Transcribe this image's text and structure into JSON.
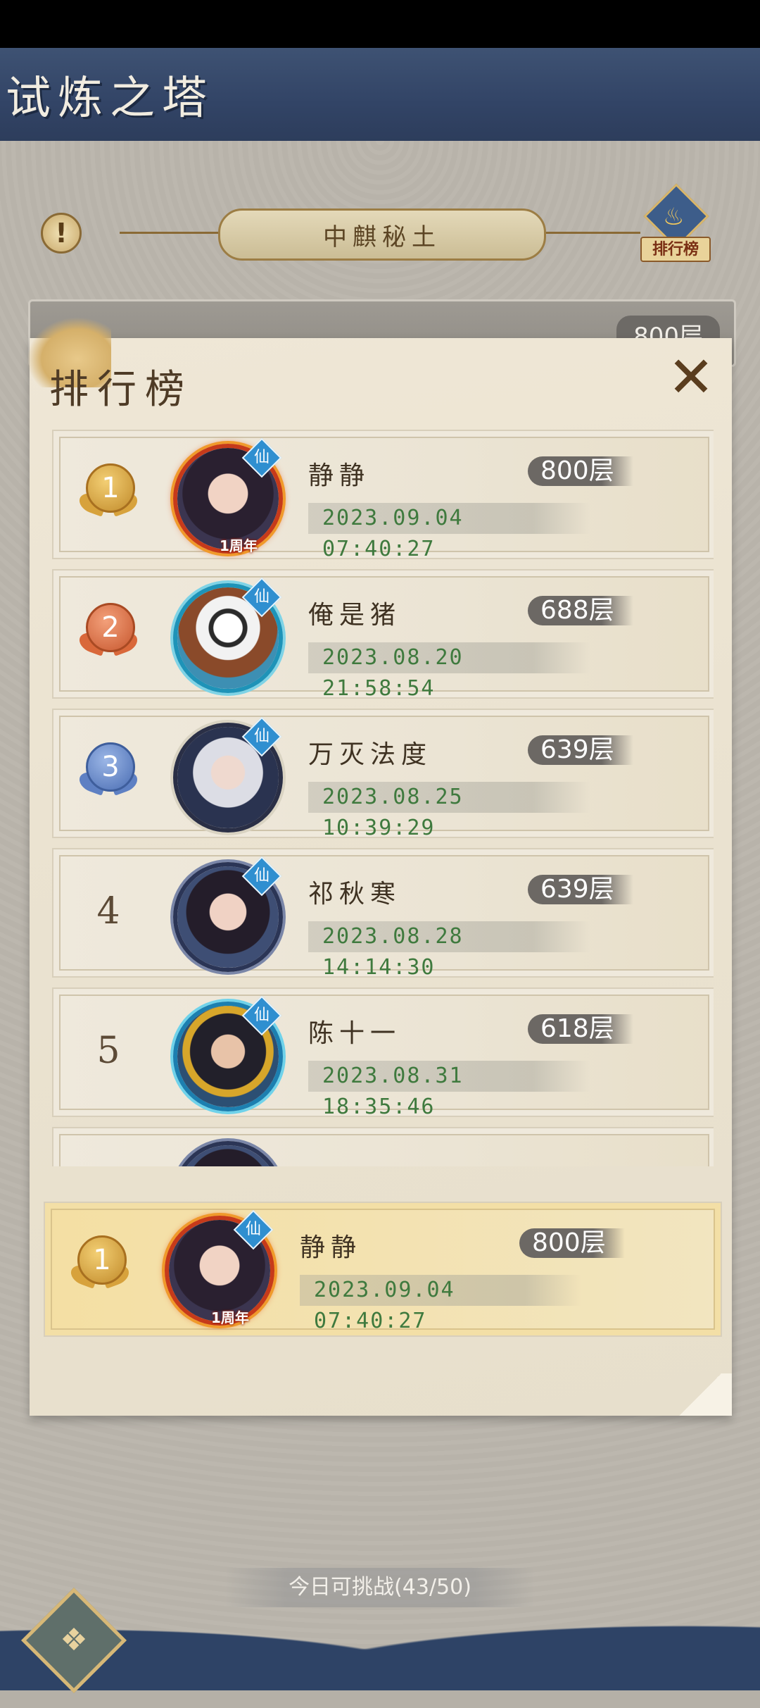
{
  "header": {
    "title": "试炼之塔"
  },
  "stage": {
    "name": "中麒秘土",
    "info_icon": "!"
  },
  "rank_button": {
    "label": "排行榜",
    "icon": "flame-emblem-icon"
  },
  "tower": {
    "floor_label": "800层"
  },
  "panel": {
    "title": "排行榜",
    "close_icon": "✕",
    "entries": [
      {
        "rank": "1",
        "medal": "gold",
        "name": "静静",
        "floor": "800层",
        "time": "2023.09.04  07:40:27",
        "avatar_badge": "仙",
        "frame_tag": "1周年"
      },
      {
        "rank": "2",
        "medal": "silver",
        "name": "俺是猪",
        "floor": "688层",
        "time": "2023.08.20  21:58:54",
        "avatar_badge": "仙"
      },
      {
        "rank": "3",
        "medal": "bronze",
        "name": "万灭法度",
        "floor": "639层",
        "time": "2023.08.25  10:39:29",
        "avatar_badge": "仙"
      },
      {
        "rank": "4",
        "name": "祁秋寒",
        "floor": "639层",
        "time": "2023.08.28  14:14:30",
        "avatar_badge": "仙"
      },
      {
        "rank": "5",
        "name": "陈十一",
        "floor": "618层",
        "time": "2023.08.31  18:35:46",
        "avatar_badge": "仙"
      }
    ],
    "my_entry": {
      "rank": "1",
      "medal": "gold",
      "name": "静静",
      "floor": "800层",
      "time": "2023.09.04  07:40:27",
      "avatar_badge": "仙",
      "frame_tag": "1周年"
    }
  },
  "footer": {
    "challenge_text": "今日可挑战(43/50)",
    "menu_icon": "menu-knot-icon"
  }
}
